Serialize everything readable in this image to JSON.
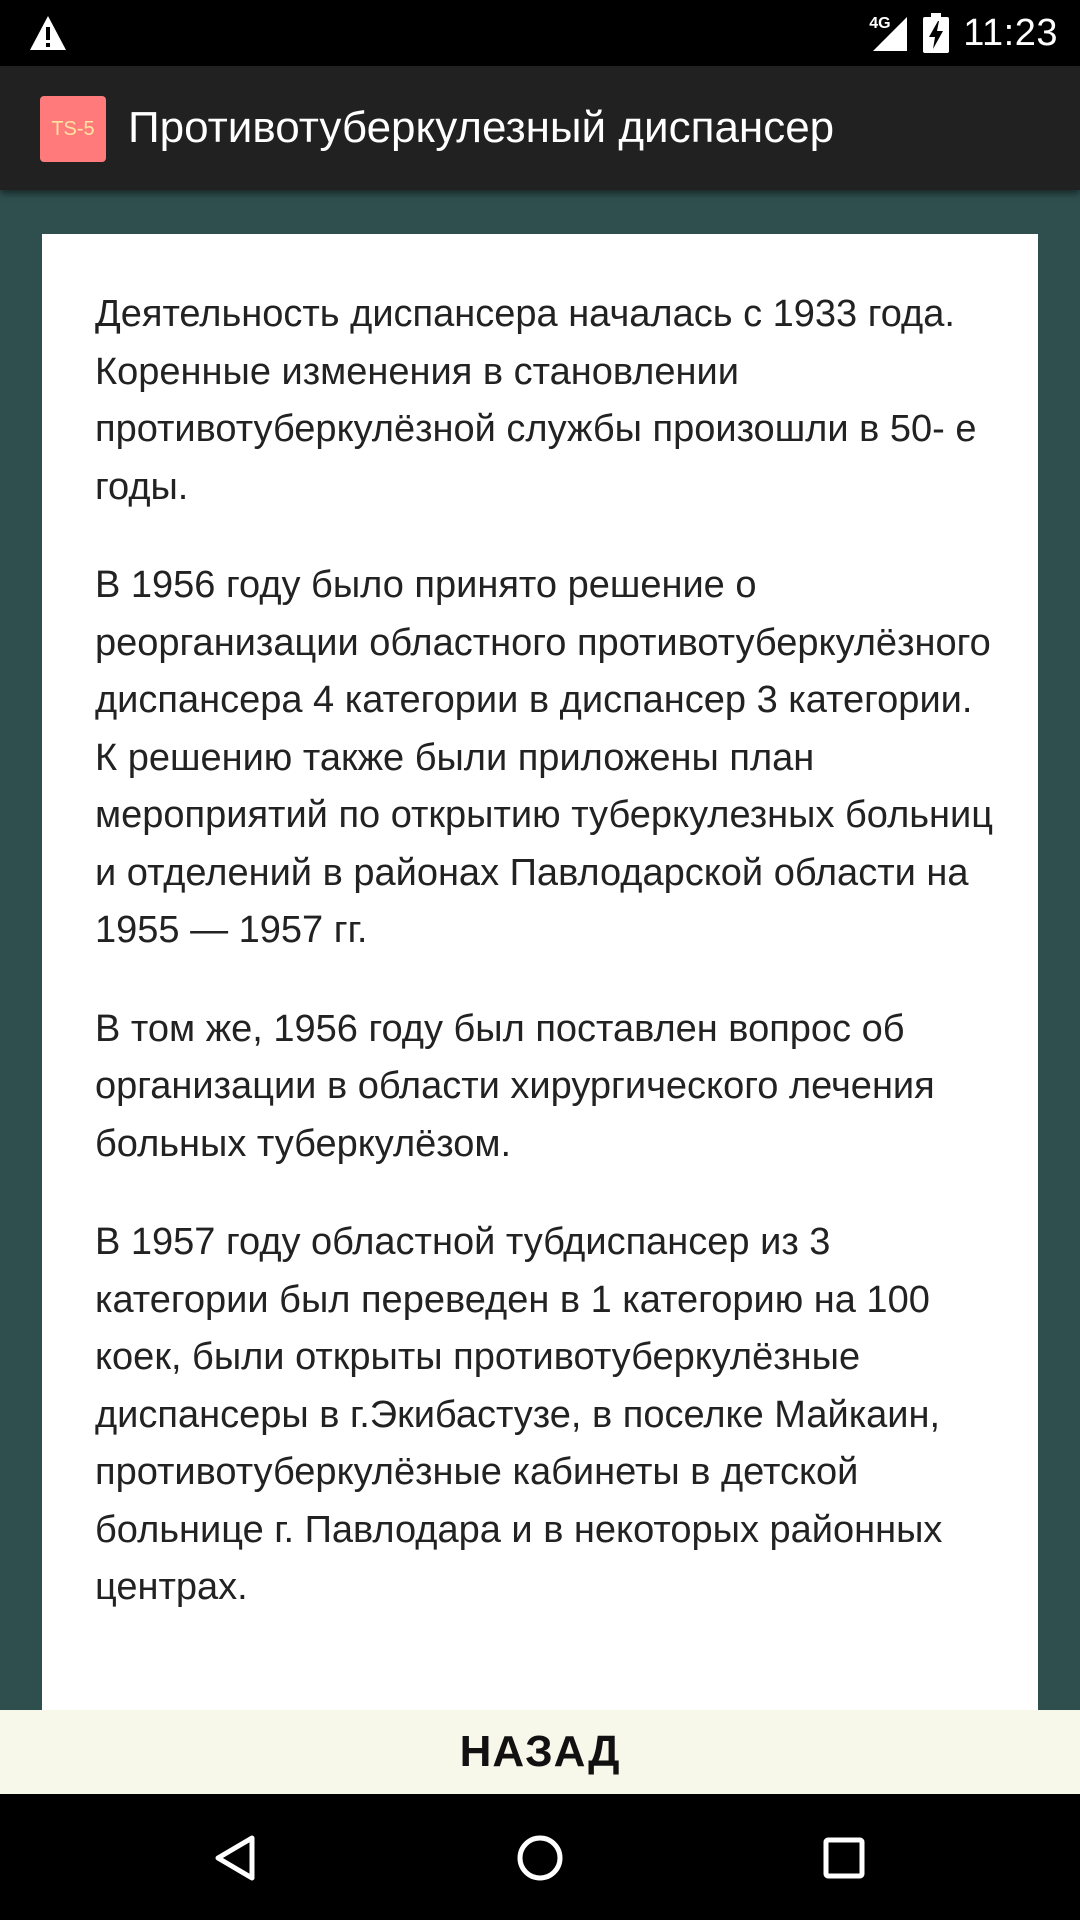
{
  "status_bar": {
    "network_type": "4G",
    "time": "11:23",
    "icons": [
      "warning-icon",
      "cell-signal-icon",
      "battery-charging-icon"
    ]
  },
  "action_bar": {
    "app_icon_text": "TS-5",
    "title": "Противотуберкулезный диспансер"
  },
  "content": {
    "paragraphs": [
      "Деятельность диспансера началась с 1933 года. Коренные изменения в становлении противотуберкулёзной службы произошли в 50- е годы.",
      "В 1956 году было принято решение о реорганизации областного противотуберкулёзного диспансера 4 категории в диспансер 3 категории. К решению также были приложены план мероприятий по открытию туберкулезных больниц и отделений в районах Павлодарской области на 1955 — 1957 гг.",
      "В том же, 1956 году был поставлен вопрос об организации в области хирургического лечения больных туберкулёзом.",
      "В 1957 году областной тубдиспансер из 3 категории был переведен в 1 категорию на 100 коек, были открыты противотуберкулёзные диспансеры в г.Экибастузе, в поселке Майкаин, противотуберкулёзные кабинеты в детской больнице г. Павлодара и в некоторых районных центрах."
    ]
  },
  "back_button": {
    "label": "НАЗАД"
  },
  "nav_bar": {
    "icons": [
      "nav-back-icon",
      "nav-home-icon",
      "nav-recent-icon"
    ]
  },
  "colors": {
    "background": "#2f4f4f",
    "action_bar": "#212121",
    "app_icon": "#ff7b7b",
    "card": "#ffffff",
    "back_bar": "#f7f7ea"
  }
}
